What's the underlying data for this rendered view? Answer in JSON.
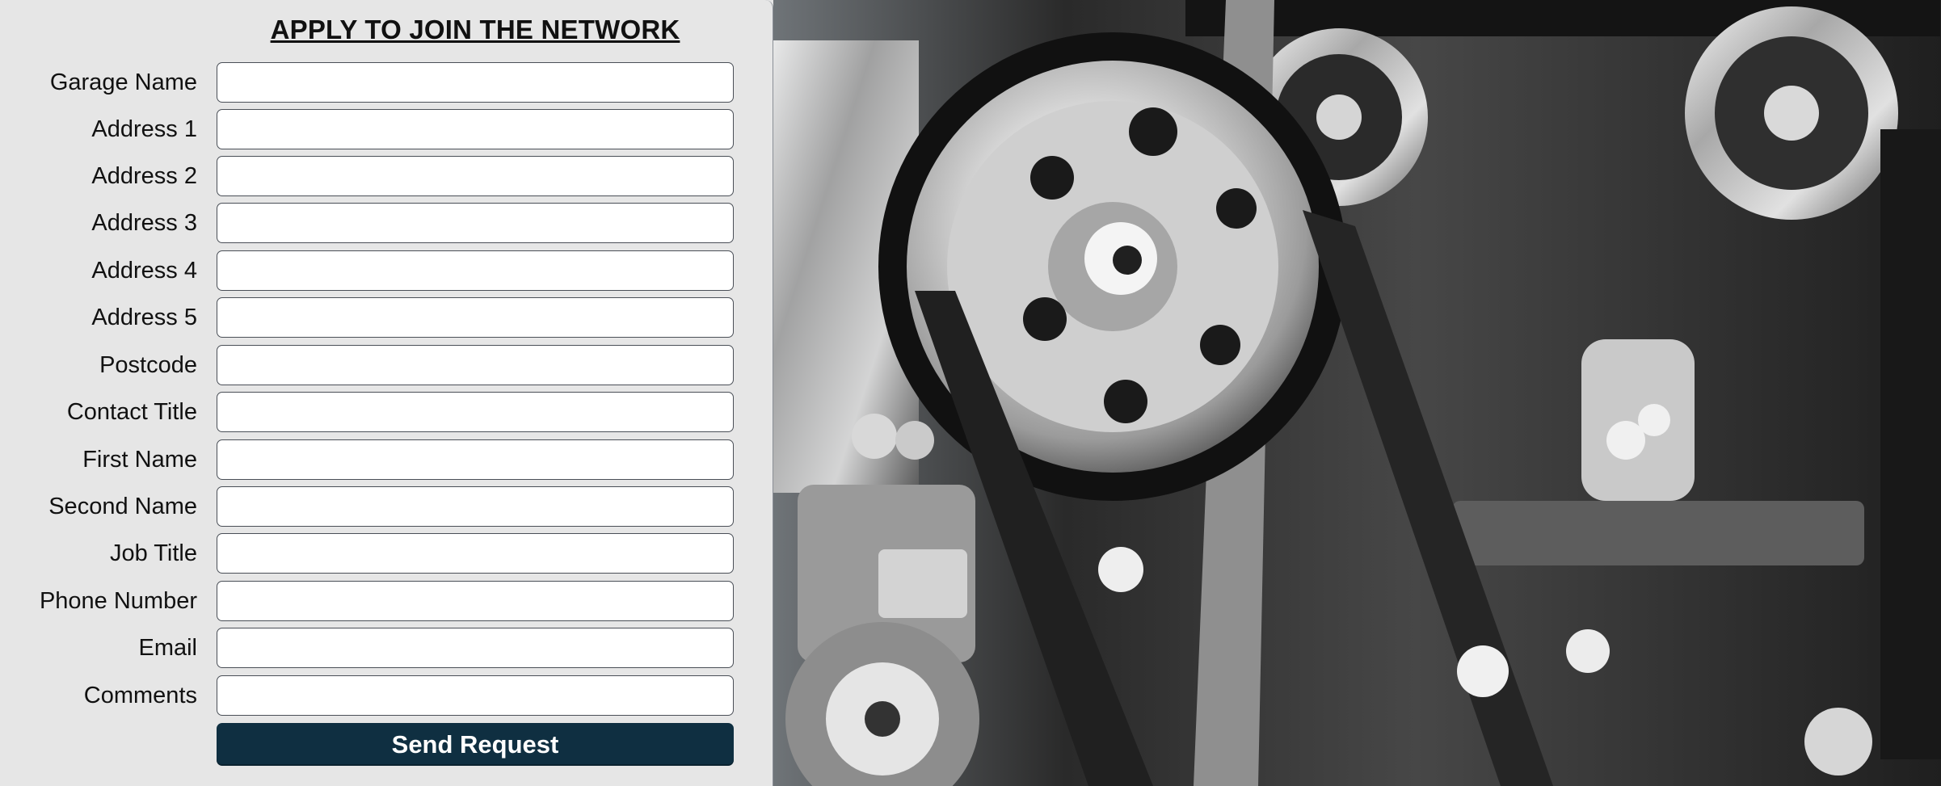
{
  "form": {
    "title": "APPLY TO JOIN THE NETWORK",
    "fields": [
      {
        "label": "Garage Name",
        "value": "",
        "placeholder": ""
      },
      {
        "label": "Address 1",
        "value": "",
        "placeholder": ""
      },
      {
        "label": "Address 2",
        "value": "",
        "placeholder": ""
      },
      {
        "label": "Address 3",
        "value": "",
        "placeholder": ""
      },
      {
        "label": "Address 4",
        "value": "",
        "placeholder": ""
      },
      {
        "label": "Address 5",
        "value": "",
        "placeholder": ""
      },
      {
        "label": "Postcode",
        "value": "",
        "placeholder": ""
      },
      {
        "label": "Contact Title",
        "value": "",
        "placeholder": ""
      },
      {
        "label": "First Name",
        "value": "",
        "placeholder": ""
      },
      {
        "label": "Second Name",
        "value": "",
        "placeholder": ""
      },
      {
        "label": "Job Title",
        "value": "",
        "placeholder": ""
      },
      {
        "label": "Phone Number",
        "value": "",
        "placeholder": ""
      },
      {
        "label": "Email",
        "value": "",
        "placeholder": ""
      },
      {
        "label": "Comments",
        "value": "",
        "placeholder": ""
      }
    ],
    "submit_label": "Send Request"
  },
  "colors": {
    "panel_background": "#e6e6e6",
    "button_background": "#0f2f41",
    "button_text": "#ffffff",
    "input_border": "#4a4f57"
  },
  "image": {
    "semantic": "engine-pulley-belt-photo"
  }
}
